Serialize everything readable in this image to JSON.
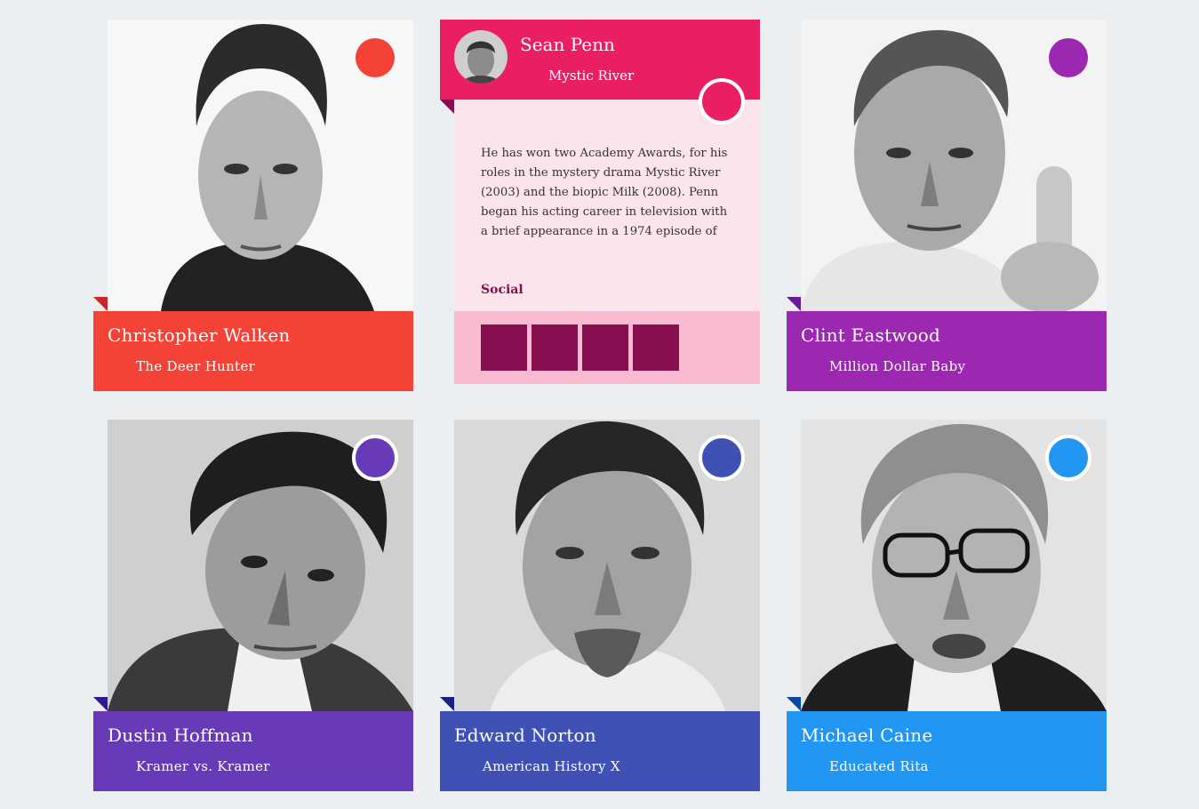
{
  "colors": {
    "page_bg": "#eceff1",
    "red": "#f44336",
    "pink": "#e91e63",
    "purple": "#9c27b0",
    "deep_purple": "#673ab7",
    "indigo": "#3f51b5",
    "blue": "#2196f3",
    "pink_light": "#fce4ec",
    "pink_footer": "#f8bbd0",
    "social_btn": "#880e4f"
  },
  "cards": [
    {
      "name": "Christopher Walken",
      "movie": "The Deer Hunter",
      "color": "red",
      "icon": "portrait-photo"
    },
    {
      "name": "Sean Penn",
      "movie": "Mystic River",
      "color": "pink",
      "expanded": true,
      "bio": "He has won two Academy Awards, for his roles in the mystery drama Mystic River (2003) and the biopic Milk (2008). Penn began his acting career in television with a brief appearance in a 1974 episode of",
      "social_title": "Social",
      "icon": "avatar-photo"
    },
    {
      "name": "Clint Eastwood",
      "movie": "Million Dollar Baby",
      "color": "purple",
      "icon": "portrait-photo"
    },
    {
      "name": "Dustin Hoffman",
      "movie": "Kramer vs. Kramer",
      "color": "deep_purple",
      "icon": "portrait-photo"
    },
    {
      "name": "Edward Norton",
      "movie": "American History X",
      "color": "indigo",
      "icon": "portrait-photo"
    },
    {
      "name": "Michael Caine",
      "movie": "Educated Rita",
      "color": "blue",
      "icon": "portrait-photo"
    }
  ]
}
